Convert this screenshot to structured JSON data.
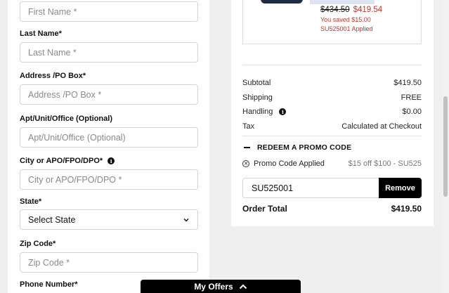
{
  "form": {
    "first_name_placeholder": "First Name *",
    "last_name_label": "Last Name*",
    "last_name_placeholder": "Last Name *",
    "address_label": "Address /PO Box*",
    "address_placeholder": "Address /PO Box *",
    "apt_label": "Apt/Unit/Office (Optional)",
    "apt_placeholder": "Apt/Unit/Office (Optional)",
    "city_label": "City or APO/FPO/DPO*",
    "city_placeholder": "City or APO/FPO/DPO *",
    "state_label": "State*",
    "state_value": "Select State",
    "zip_label": "Zip Code*",
    "zip_placeholder": "Zip Code *",
    "phone_label": "Phone Number*"
  },
  "product": {
    "old_price": "$434.50",
    "new_price": "$419.54",
    "saved_text": "You saved $15.00",
    "code_applied": "SU525001 Applied"
  },
  "summary": {
    "subtotal_label": "Subtotal",
    "subtotal_value": "$419.50",
    "shipping_label": "Shipping",
    "shipping_value": "FREE",
    "handling_label": "Handling",
    "handling_value": "$0.00",
    "tax_label": "Tax",
    "tax_value": "Calculated at Checkout",
    "promo_heading": "REDEEM A PROMO CODE",
    "promo_applied_label": "Promo Code Applied",
    "promo_applied_value": "$15 off $100 - SU525",
    "promo_input_value": "SU525001",
    "remove_label": "Remove",
    "order_total_label": "Order Total",
    "order_total_value": "$419.50"
  },
  "offers": {
    "label": "My Offers"
  },
  "colors": {
    "sale_red": "#c0392b",
    "button_black": "#000000"
  }
}
